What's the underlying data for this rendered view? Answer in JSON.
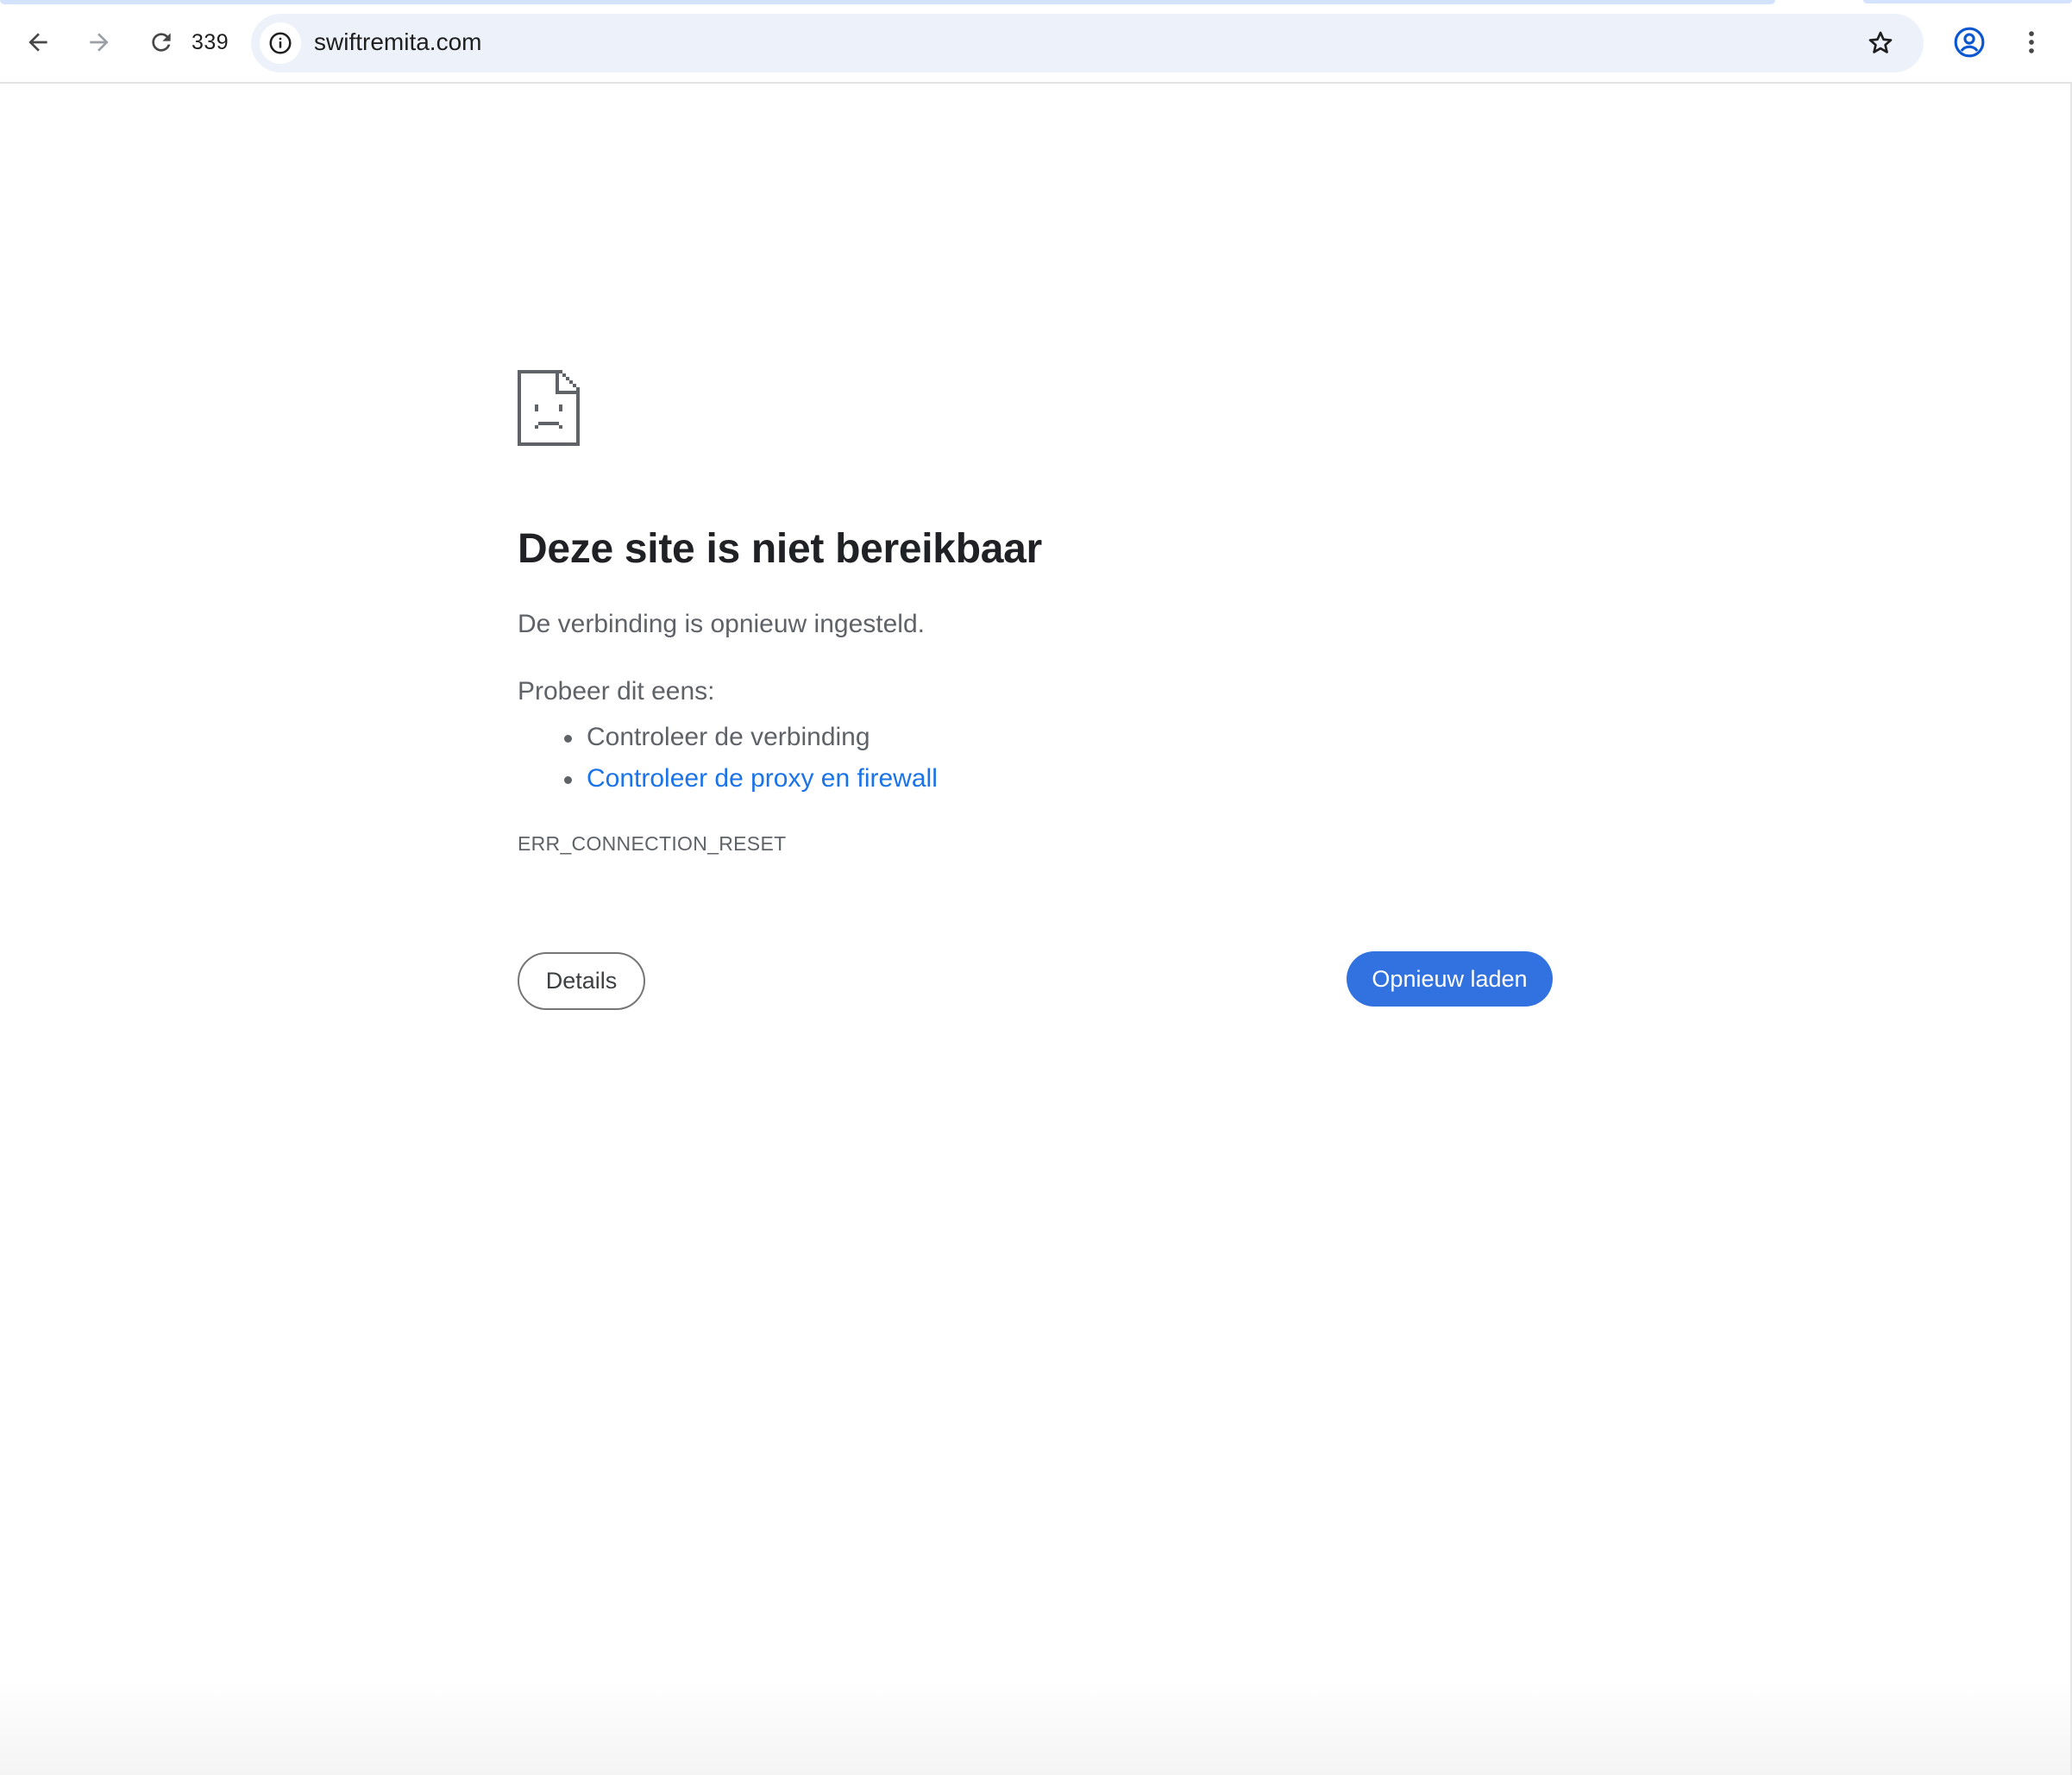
{
  "browser": {
    "tab_count": "339",
    "url": "swiftremita.com",
    "colors": {
      "omnibox_bg": "#edf2fa",
      "accent": "#1a73e8",
      "tab_strip": "#d3e3fd"
    },
    "icons": {
      "back": "arrow-left-icon",
      "forward": "arrow-right-icon",
      "reload": "reload-icon",
      "site_info": "info-icon",
      "bookmark": "star-icon",
      "profile": "account-circle-icon",
      "menu": "vertical-dots-icon"
    }
  },
  "error_page": {
    "icon": "sad-page-icon",
    "title": "Deze site is niet bereikbaar",
    "description": "De verbinding is opnieuw ingesteld.",
    "suggestions_heading": "Probeer dit eens:",
    "suggestions": [
      {
        "label": "Controleer de verbinding",
        "is_link": false
      },
      {
        "label": "Controleer de proxy en firewall",
        "is_link": true
      }
    ],
    "error_code": "ERR_CONNECTION_RESET",
    "details_button": "Details",
    "reload_button": "Opnieuw laden",
    "colors": {
      "title": "#202124",
      "body_text": "#5f6368",
      "link": "#1a73e8",
      "primary_button": "#3172e0"
    }
  }
}
